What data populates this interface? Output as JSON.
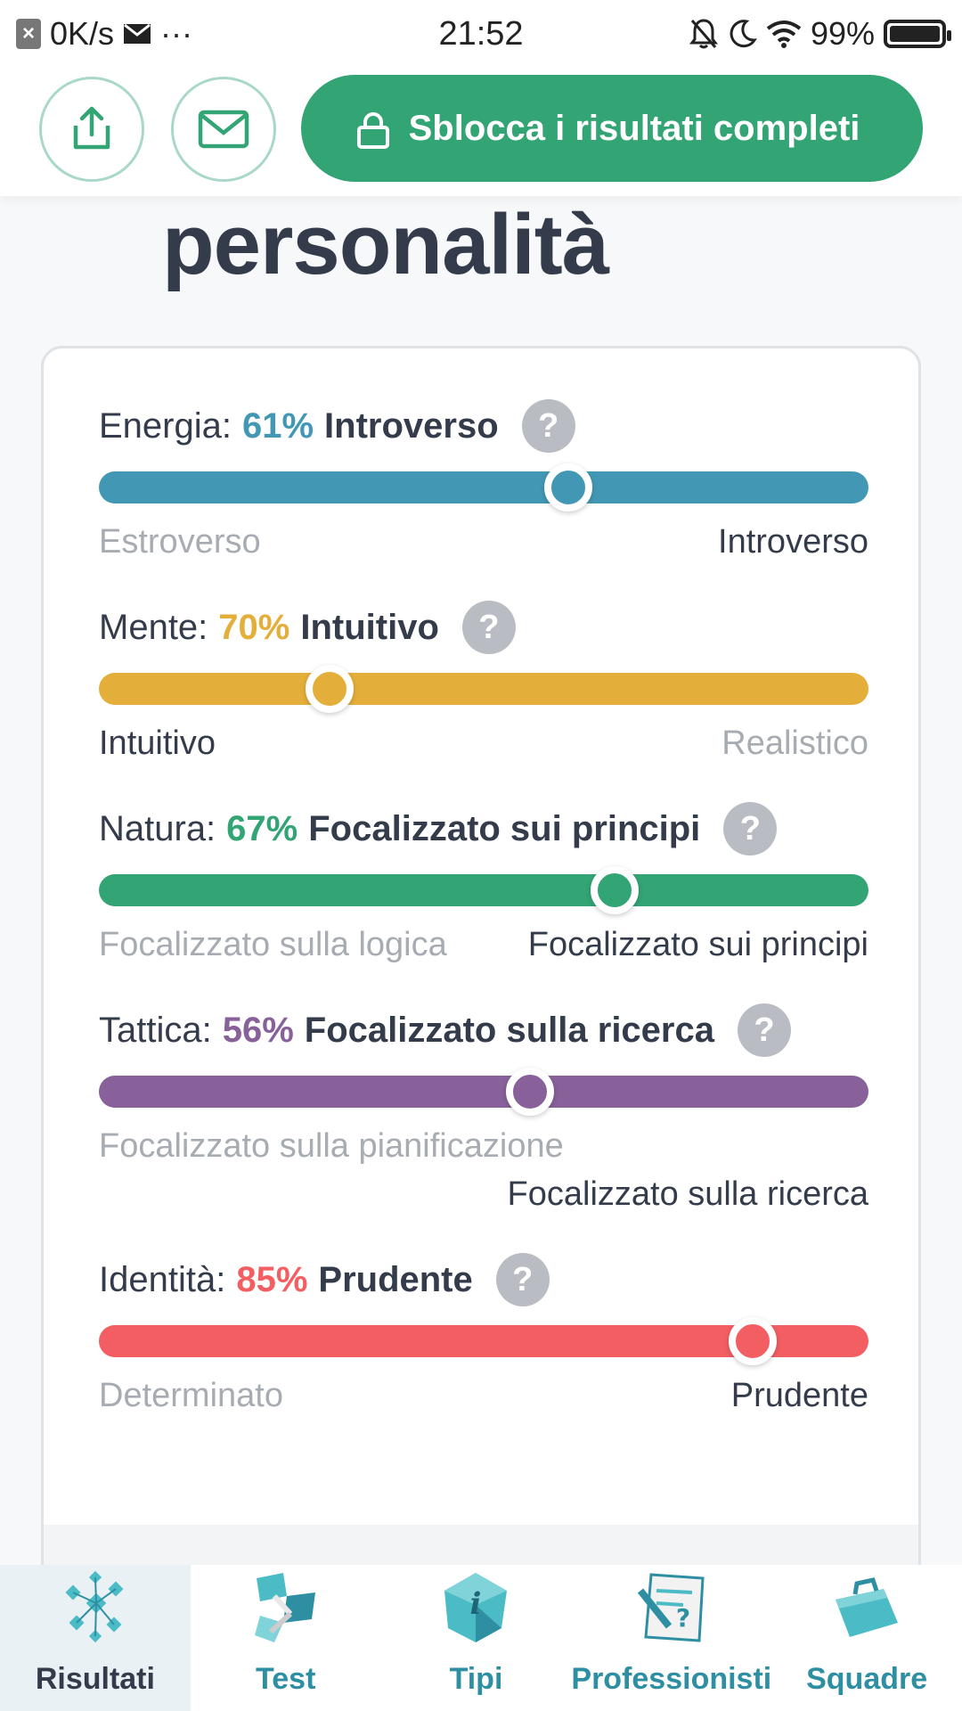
{
  "status_bar": {
    "net_speed": "0K/s",
    "more": "···",
    "time": "21:52",
    "battery": "99%"
  },
  "header": {
    "unlock_label": "Sblocca i risultati completi"
  },
  "page_title": "personalità",
  "traits": [
    {
      "label": "Energia:",
      "percent": "61%",
      "name": "Introverso",
      "color": "#4298b4",
      "left_pole": "Estroverso",
      "right_pole": "Introverso",
      "active": "right",
      "position": 0.61
    },
    {
      "label": "Mente:",
      "percent": "70%",
      "name": "Intuitivo",
      "color": "#e4ae3a",
      "left_pole": "Intuitivo",
      "right_pole": "Realistico",
      "active": "left",
      "position": 0.3
    },
    {
      "label": "Natura:",
      "percent": "67%",
      "name": "Focalizzato sui principi",
      "color": "#33a474",
      "left_pole": "Focalizzato sulla logica",
      "right_pole": "Focalizzato sui principi",
      "active": "right",
      "position": 0.67
    },
    {
      "label": "Tattica:",
      "percent": "56%",
      "name": "Focalizzato sulla ricerca",
      "color": "#88619a",
      "left_pole": "Focalizzato sulla pianificazione",
      "right_pole": "Focalizzato sulla ricerca",
      "active": "right",
      "position": 0.56
    },
    {
      "label": "Identità:",
      "percent": "85%",
      "name": "Prudente",
      "color": "#f25e62",
      "left_pole": "Determinato",
      "right_pole": "Prudente",
      "active": "right",
      "position": 0.85
    }
  ],
  "nav": [
    {
      "label": "Risultati",
      "icon": "results-icon",
      "active": true
    },
    {
      "label": "Test",
      "icon": "test-icon",
      "active": false
    },
    {
      "label": "Tipi",
      "icon": "types-icon",
      "active": false
    },
    {
      "label": "Professionisti",
      "icon": "professionals-icon",
      "active": false
    },
    {
      "label": "Squadre",
      "icon": "teams-icon",
      "active": false
    }
  ],
  "colors": {
    "accent": "#33a474",
    "text": "#343c4b",
    "muted": "#a7abb2",
    "nav_link": "#2e8fa3"
  }
}
